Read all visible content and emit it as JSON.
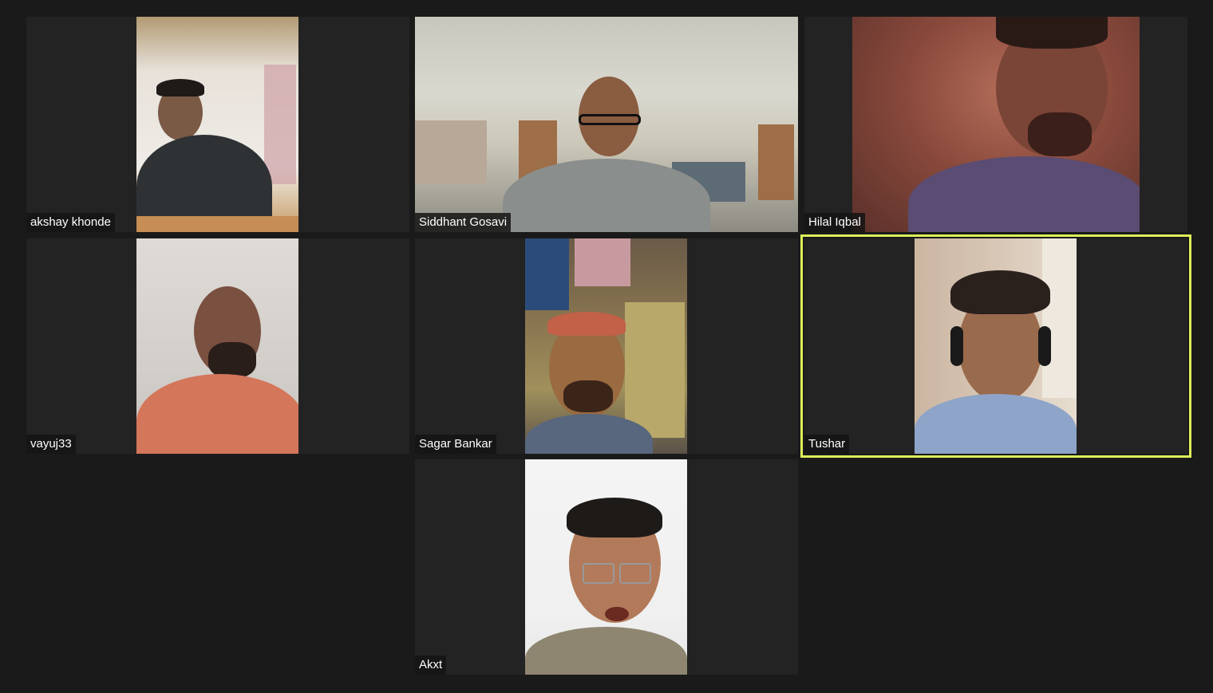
{
  "participants": [
    {
      "name": "akshay khonde"
    },
    {
      "name": "Siddhant Gosavi"
    },
    {
      "name": "Hilal Iqbal"
    },
    {
      "name": "vayuj33"
    },
    {
      "name": "Sagar Bankar"
    },
    {
      "name": "Tushar",
      "active_speaker": true
    },
    {
      "name": "Akxt"
    }
  ],
  "colors": {
    "background": "#1a1a1a",
    "tile_background": "#232323",
    "active_speaker_border": "#dcef5a",
    "name_text": "#ffffff"
  }
}
